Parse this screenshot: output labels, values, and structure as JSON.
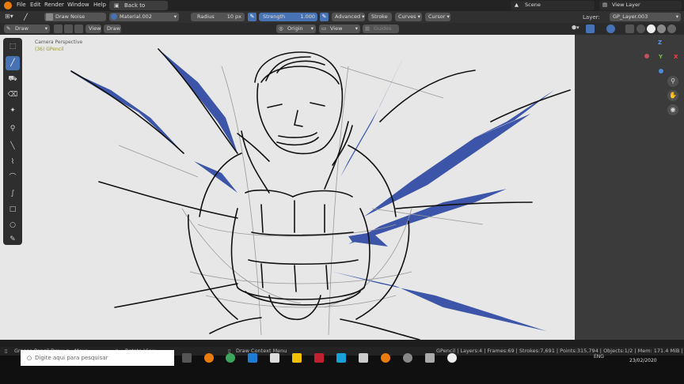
{
  "menu": [
    "File",
    "Edit",
    "Render",
    "Window",
    "Help"
  ],
  "back_label": "Back to Previous",
  "scene_label": "Scene",
  "view_layer_label": "View Layer",
  "tool_header": {
    "brush": "Draw Noise",
    "material": "Material.002",
    "radius_label": "Radius",
    "radius_value": "10 px",
    "strength_label": "Strength",
    "strength_value": "1.000",
    "advanced": "Advanced",
    "stroke": "Stroke",
    "curves": "Curves",
    "cursor": "Cursor",
    "layer_label": "Layer:",
    "layer_value": "GP_Layer.003"
  },
  "header2": {
    "mode": "Draw",
    "view": "View",
    "draw": "Draw",
    "origin": "Origin",
    "view2": "View",
    "guides": "Guides"
  },
  "viewport": {
    "camera_label": "Camera Perspective",
    "object_label": "(36) GPencil"
  },
  "axis": {
    "z": "Z",
    "y": "Y",
    "x": "X"
  },
  "status": {
    "left1": "Grease Pencil Draw",
    "left2": "Move",
    "left3": "Rotate View",
    "middle": "Draw Context Menu",
    "right": "GPencil | Layers:4 | Frames:69 | Strokes:7,691 | Points:315,794 | Objects:1/2 | Mem: 171.4 MiB | v2.82.7"
  },
  "taskbar": {
    "search_placeholder": "Digite aqui para pesquisar",
    "date": "23/02/2020",
    "lang": "ENG"
  },
  "colors": {
    "accent": "#4772b3",
    "stroke_blue": "#3d55a8"
  }
}
